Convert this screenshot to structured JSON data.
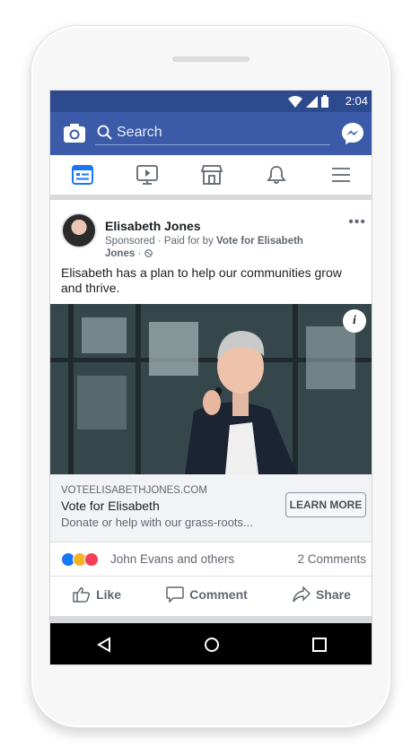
{
  "status_bar": {
    "time": "2:04"
  },
  "app_bar": {
    "search_placeholder": "Search"
  },
  "post": {
    "author": "Elisabeth Jones",
    "sponsored": "Sponsored",
    "paid_for_prefix": "· Paid for by",
    "paid_for_by": "Vote for Elisabeth Jones",
    "text": "Elisabeth has a plan to help our communities grow and thrive.",
    "info_glyph": "i"
  },
  "link_card": {
    "domain": "VOTEELISABETHJONES.COM",
    "headline": "Vote for Elisabeth",
    "description": "Donate or help with our grass-roots...",
    "cta": "LEARN MORE"
  },
  "reactions": {
    "names": "John Evans and others",
    "comments": "2 Comments",
    "icons": [
      "like-reaction",
      "wow-reaction",
      "love-reaction"
    ]
  },
  "actions": {
    "like": "Like",
    "comment": "Comment",
    "share": "Share"
  },
  "colors": {
    "brand_blue": "#3b5ba9",
    "status_blue": "#2d4a8f",
    "nav_black": "#000000"
  }
}
